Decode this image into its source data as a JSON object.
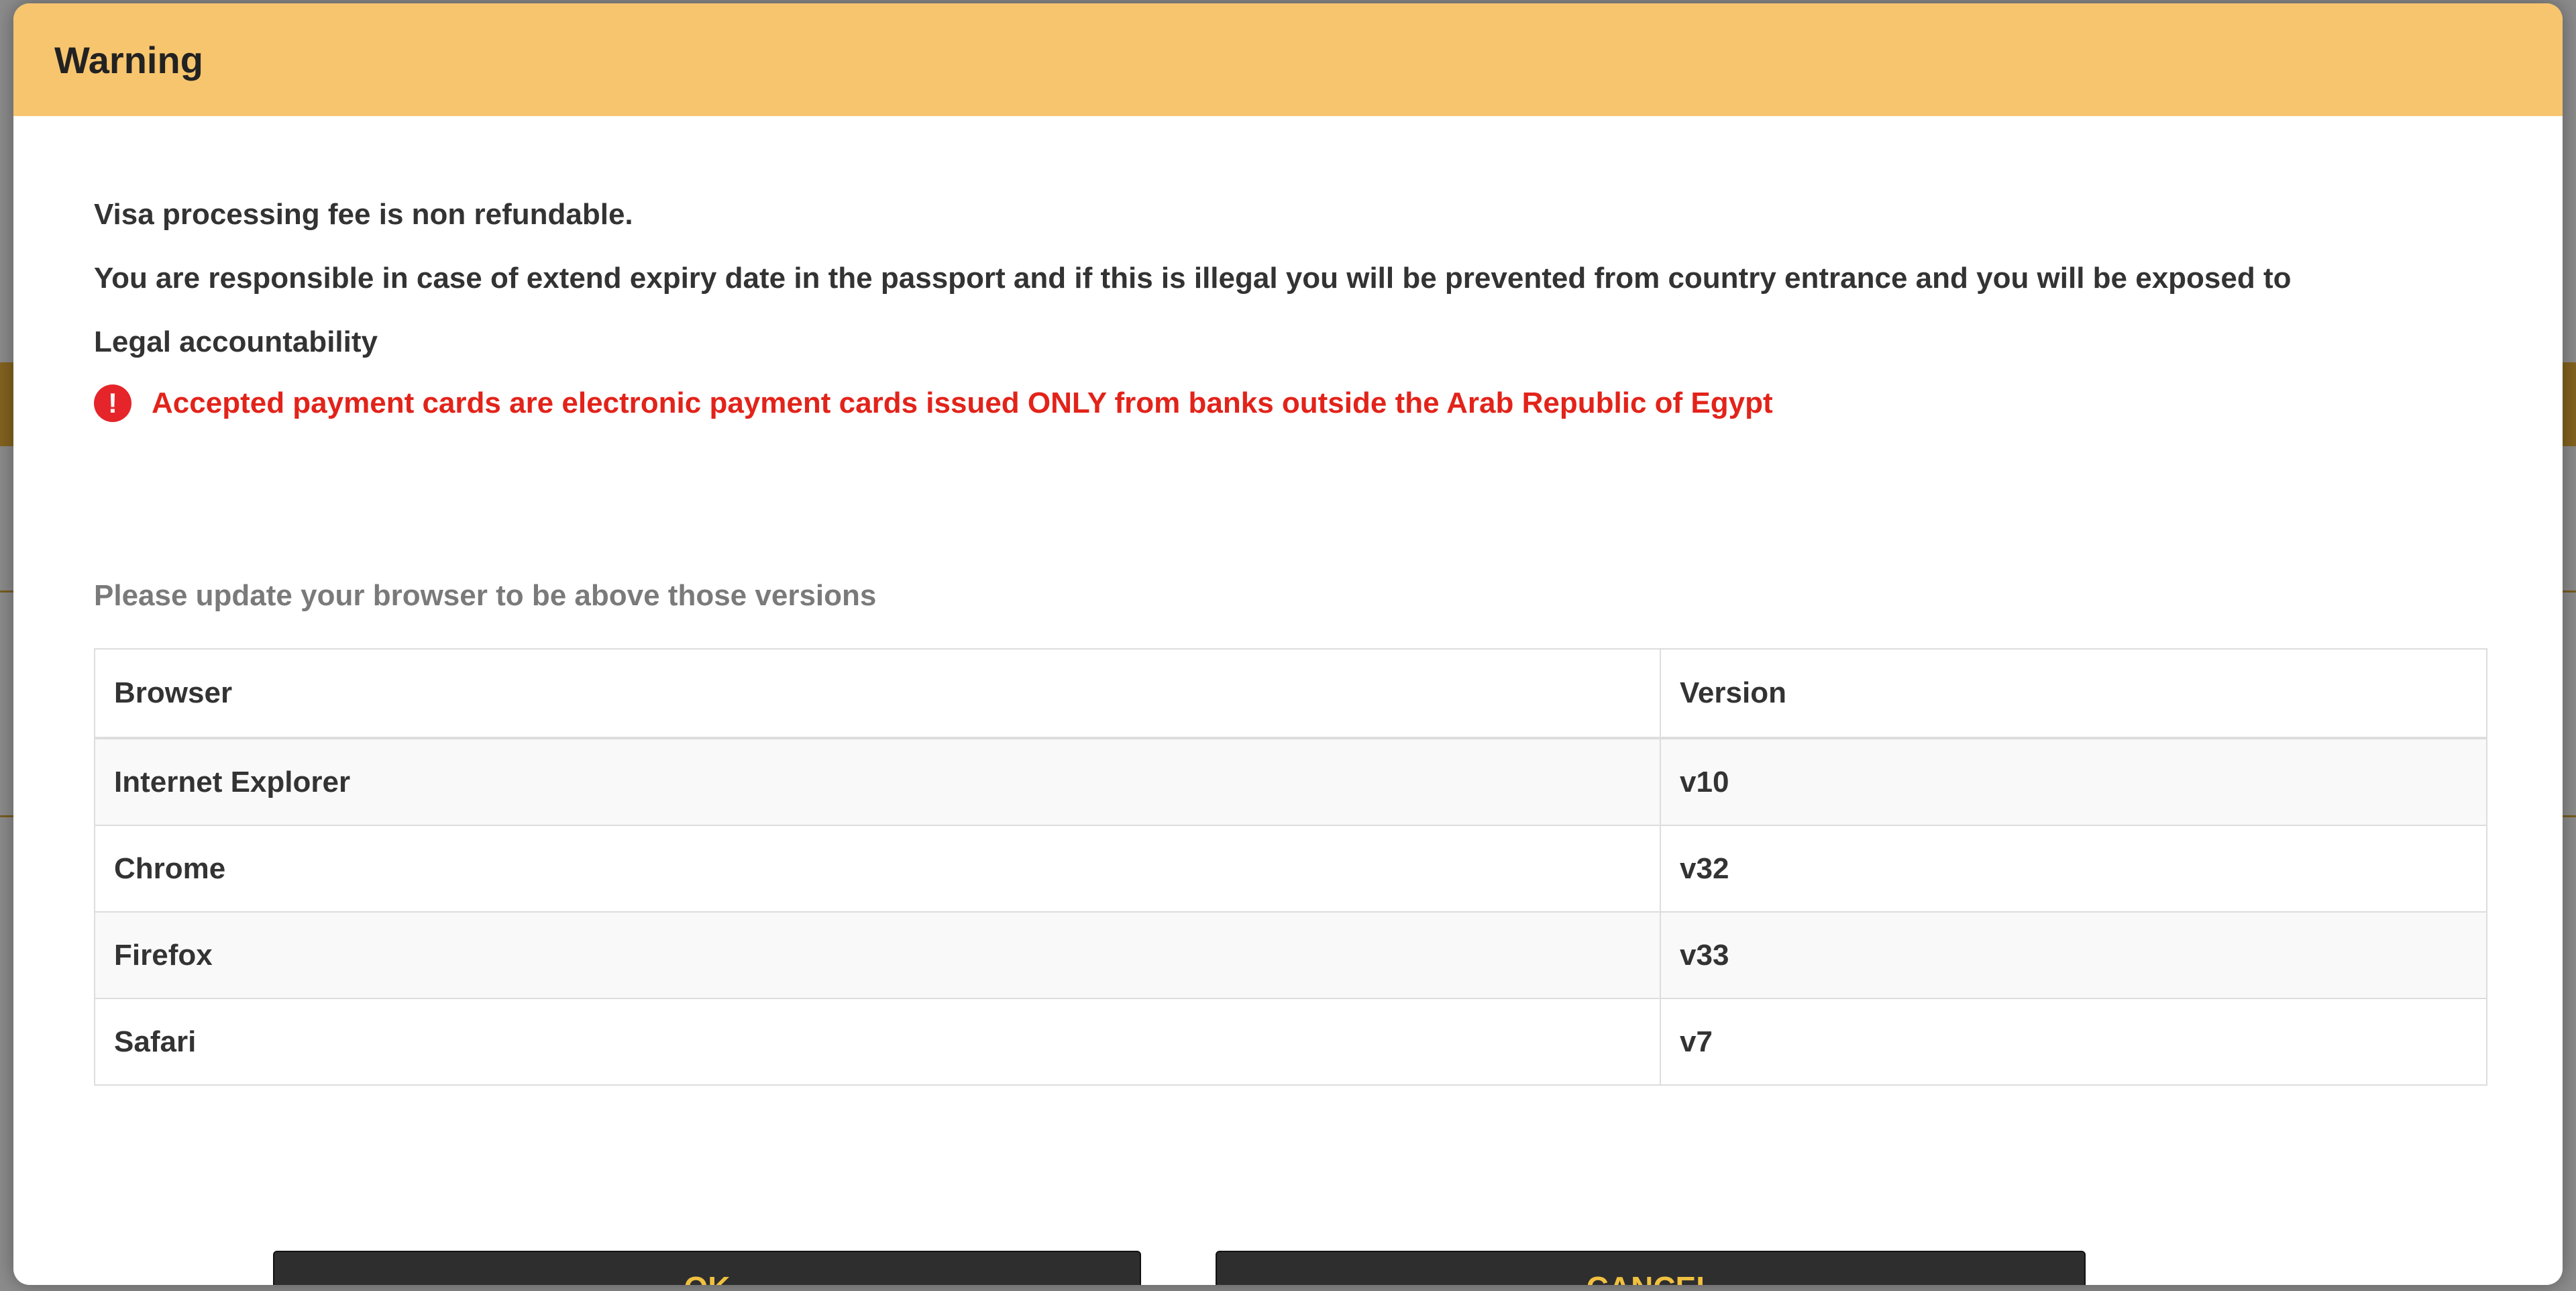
{
  "dialog": {
    "title": "Warning",
    "messages": [
      "Visa processing fee is non refundable.",
      "You are responsible in case of extend expiry date in the passport and if this is illegal you will be prevented from country entrance and you will be exposed to",
      "Legal accountability"
    ],
    "payment_warning": "Accepted payment cards are electronic payment cards issued ONLY from banks outside the Arab Republic of Egypt",
    "warning_icon": "exclamation-circle-icon",
    "browser_note": "Please update your browser to be above those versions",
    "table": {
      "headers": [
        "Browser",
        "Version"
      ],
      "rows": [
        [
          "Internet Explorer",
          "v10"
        ],
        [
          "Chrome",
          "v32"
        ],
        [
          "Firefox",
          "v33"
        ],
        [
          "Safari",
          "v7"
        ]
      ]
    },
    "buttons": {
      "ok": "OK",
      "cancel": "CANCEL"
    },
    "colors": {
      "header_bg": "#f7c56e",
      "warning_text": "#e2231a",
      "button_bg": "#2e2e2e",
      "button_text": "#f0c040"
    }
  }
}
